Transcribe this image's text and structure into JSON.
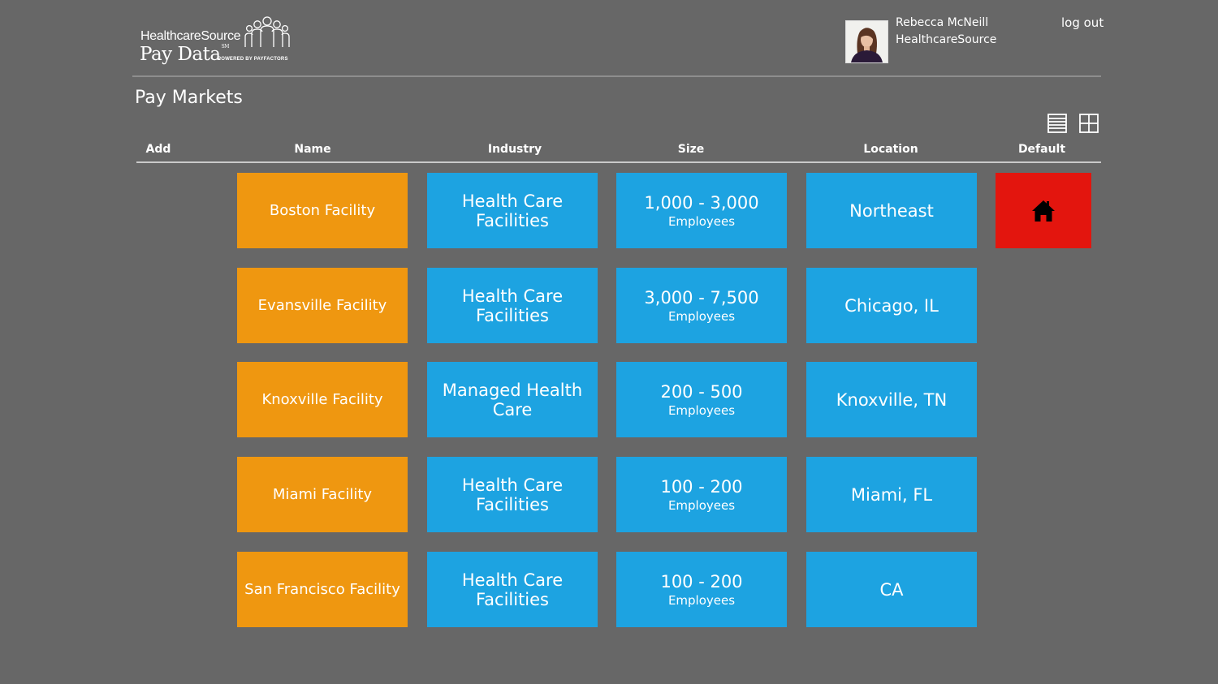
{
  "header": {
    "brand": "HealthcareSource",
    "product": "Pay Data",
    "sm_mark": "SM",
    "powered_by": "POWERED BY PAYFACTORS",
    "user_name": "Rebecca McNeill",
    "user_org": "HealthcareSource",
    "logout_label": "log out"
  },
  "page": {
    "title": "Pay Markets"
  },
  "view_toggle": {
    "list_icon": "list-view-icon",
    "tile_icon": "tile-view-icon"
  },
  "columns": {
    "add": "Add",
    "name": "Name",
    "industry": "Industry",
    "size": "Size",
    "location": "Location",
    "default": "Default"
  },
  "rows": [
    {
      "name": "Boston Facility",
      "industry": "Health Care Facilities",
      "size_range": "1,000 - 3,000",
      "size_unit": "Employees",
      "location": "Northeast",
      "is_default": true
    },
    {
      "name": "Evansville Facility",
      "industry": "Health Care Facilities",
      "size_range": "3,000 - 7,500",
      "size_unit": "Employees",
      "location": "Chicago, IL",
      "is_default": false
    },
    {
      "name": "Knoxville Facility",
      "industry": "Managed Health Care",
      "size_range": "200 - 500",
      "size_unit": "Employees",
      "location": "Knoxville, TN",
      "is_default": false
    },
    {
      "name": "Miami Facility",
      "industry": "Health Care Facilities",
      "size_range": "100 - 200",
      "size_unit": "Employees",
      "location": "Miami, FL",
      "is_default": false
    },
    {
      "name": "San Francisco Facility",
      "industry": "Health Care Facilities",
      "size_range": "100 - 200",
      "size_unit": "Employees",
      "location": "CA",
      "is_default": false
    }
  ],
  "default_icon": "home-icon",
  "colors": {
    "background": "#676767",
    "name_tile": "#ef9710",
    "info_tile": "#1da3e1",
    "default_tile": "#e3150e"
  }
}
